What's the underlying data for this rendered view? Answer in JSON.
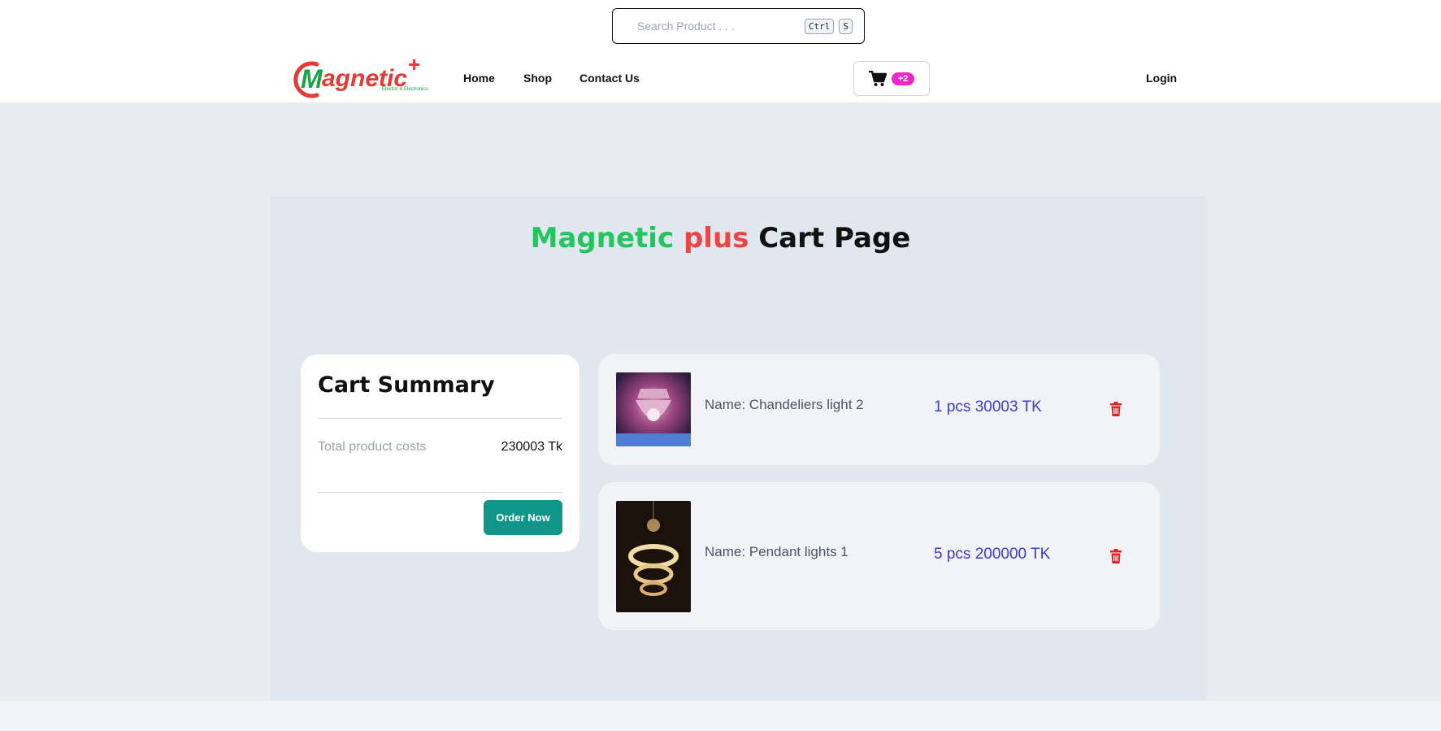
{
  "search": {
    "placeholder": "Search Product . . .",
    "shortcut_key1": "Ctrl",
    "shortcut_key2": "S"
  },
  "header": {
    "logo_text": "Magnetic",
    "logo_tagline": "Electric & Electronics",
    "nav": [
      "Home",
      "Shop",
      "Contact Us"
    ],
    "cart_badge": "+2",
    "login_label": "Login"
  },
  "title": {
    "part1": "Magnetic",
    "part2": "plus",
    "part3": "Cart Page"
  },
  "summary": {
    "heading": "Cart Summary",
    "total_label": "Total product costs",
    "total_value": "230003 Tk",
    "order_button": "Order Now"
  },
  "cart_items": [
    {
      "name": "Name: Chandeliers light 2",
      "qty_price": "1 pcs 30003 TK"
    },
    {
      "name": "Name: Pendant lights 1",
      "qty_price": "5 pcs 200000 TK"
    }
  ],
  "colors": {
    "brand_green": "#22c55e",
    "brand_red": "#ef4444",
    "order_button": "#0f9688",
    "price_text": "#3b3bd4",
    "badge": "#ec28c8",
    "trash": "#dc2626"
  },
  "icons": {
    "cart": "cart-icon",
    "delete": "trash-icon"
  }
}
